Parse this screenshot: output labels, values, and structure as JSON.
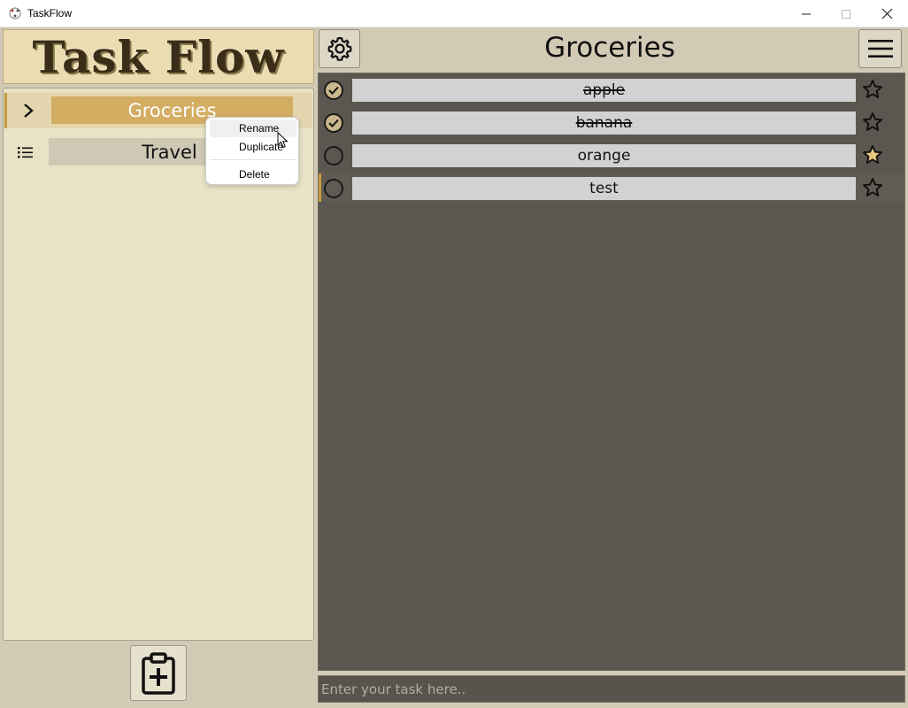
{
  "window": {
    "title": "TaskFlow",
    "minimize_icon": "minimize-icon",
    "maximize_icon": "maximize-icon",
    "close_icon": "close-icon"
  },
  "sidebar": {
    "logo": "Task Flow",
    "lists": [
      {
        "label": "Groceries",
        "icon": "chevron-right-icon",
        "selected": true
      },
      {
        "label": "Travel",
        "icon": "list-icon",
        "selected": false
      }
    ],
    "new_list_icon": "clipboard-plus-icon"
  },
  "context_menu": {
    "items": [
      {
        "label": "Rename"
      },
      {
        "label": "Duplicate"
      },
      {
        "label": "Delete"
      }
    ]
  },
  "main": {
    "title": "Groceries",
    "settings_icon": "gear-icon",
    "menu_icon": "hamburger-icon",
    "tasks": [
      {
        "label": "apple",
        "done": true,
        "starred": false
      },
      {
        "label": "banana",
        "done": true,
        "starred": false
      },
      {
        "label": "orange",
        "done": false,
        "starred": true
      },
      {
        "label": "test",
        "done": false,
        "starred": false
      }
    ],
    "input_placeholder": "Enter your task here.."
  },
  "colors": {
    "accent": "#d3ad62",
    "star_fill": "#e8c87a",
    "tasks_background": "#5b5750"
  }
}
